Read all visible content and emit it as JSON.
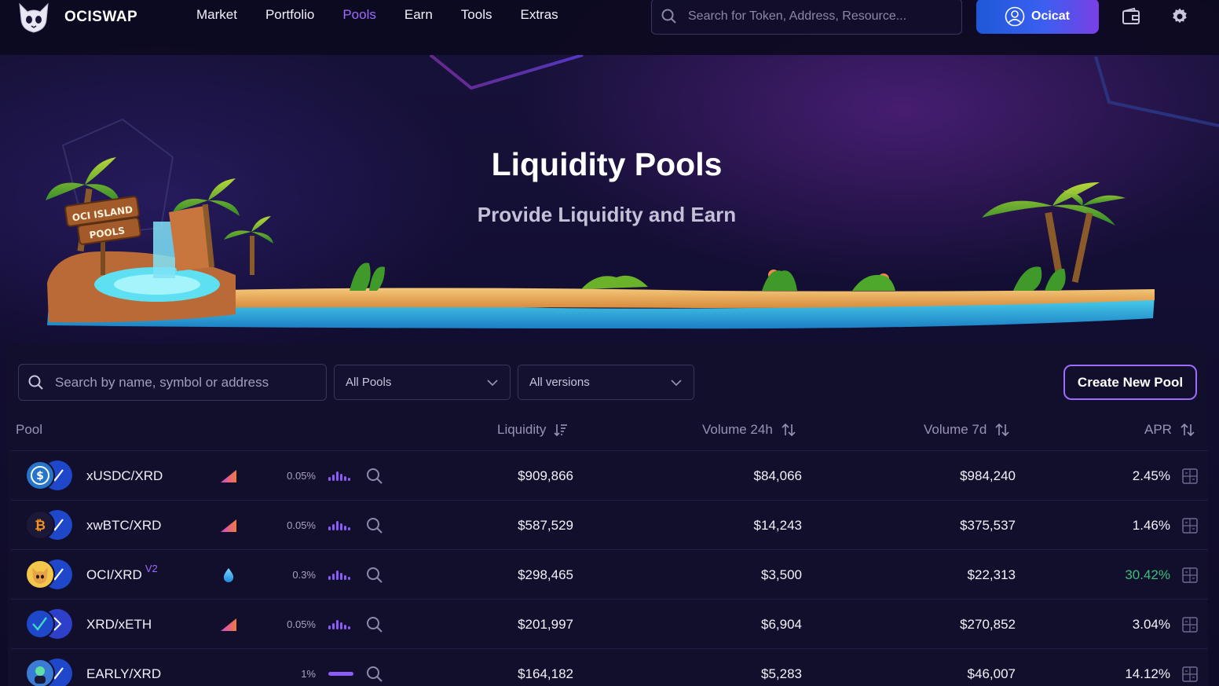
{
  "header": {
    "brand": "OCISWAP",
    "nav": [
      {
        "label": "Market",
        "active": false
      },
      {
        "label": "Portfolio",
        "active": false
      },
      {
        "label": "Pools",
        "active": true
      },
      {
        "label": "Earn",
        "active": false
      },
      {
        "label": "Tools",
        "active": false
      },
      {
        "label": "Extras",
        "active": false
      }
    ],
    "search_placeholder": "Search for Token, Address, Resource...",
    "account_label": "Ocicat"
  },
  "hero": {
    "title": "Liquidity Pools",
    "subtitle": "Provide Liquidity and Earn",
    "sign_line1": "OCI ISLAND",
    "sign_line2": "POOLS"
  },
  "filters": {
    "search_placeholder": "Search by name, symbol or address",
    "pool_type": "All Pools",
    "version": "All versions",
    "create_label": "Create New Pool"
  },
  "table": {
    "columns": {
      "pool": "Pool",
      "liquidity": "Liquidity",
      "volume24h": "Volume 24h",
      "volume7d": "Volume 7d",
      "apr": "APR"
    },
    "rows": [
      {
        "pair": "xUSDC/XRD",
        "version": "",
        "type": "concentrated",
        "fee": "0.05%",
        "chart": "bars",
        "liquidity": "$909,866",
        "volume24h": "$84,066",
        "volume7d": "$984,240",
        "apr": "2.45%",
        "apr_positive": false,
        "coin": "usdc"
      },
      {
        "pair": "xwBTC/XRD",
        "version": "",
        "type": "concentrated",
        "fee": "0.05%",
        "chart": "bars",
        "liquidity": "$587,529",
        "volume24h": "$14,243",
        "volume7d": "$375,537",
        "apr": "1.46%",
        "apr_positive": false,
        "coin": "btc"
      },
      {
        "pair": "OCI/XRD",
        "version": "V2",
        "type": "drop",
        "fee": "0.3%",
        "chart": "bars",
        "liquidity": "$298,465",
        "volume24h": "$3,500",
        "volume7d": "$22,313",
        "apr": "30.42%",
        "apr_positive": true,
        "coin": "oci"
      },
      {
        "pair": "XRD/xETH",
        "version": "",
        "type": "concentrated",
        "fee": "0.05%",
        "chart": "bars",
        "liquidity": "$201,997",
        "volume24h": "$6,904",
        "volume7d": "$270,852",
        "apr": "3.04%",
        "apr_positive": false,
        "coin": "xrd"
      },
      {
        "pair": "EARLY/XRD",
        "version": "",
        "type": "none",
        "fee": "1%",
        "chart": "line",
        "liquidity": "$164,182",
        "volume24h": "$5,283",
        "volume7d": "$46,007",
        "apr": "14.12%",
        "apr_positive": false,
        "coin": "early"
      }
    ]
  },
  "colors": {
    "accent": "#9d6cff",
    "green": "#38c07c",
    "background": "#0d0a22"
  }
}
